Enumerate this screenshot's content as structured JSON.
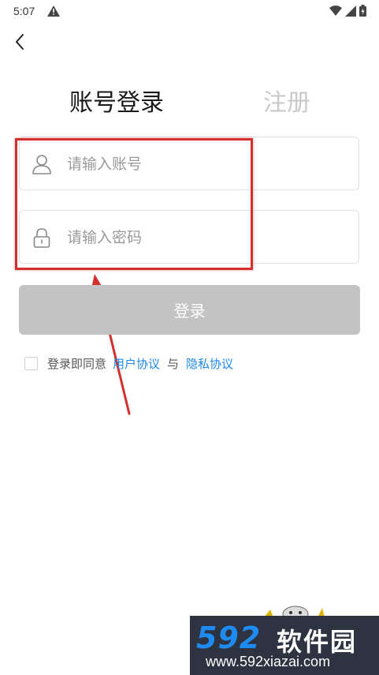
{
  "status_bar": {
    "time": "5:07",
    "icons": [
      "warning-icon",
      "wifi-icon",
      "signal-icon",
      "battery-icon"
    ]
  },
  "nav": {
    "back_icon": "chevron-left-icon"
  },
  "tabs": {
    "login": "账号登录",
    "register": "注册"
  },
  "form": {
    "account_placeholder": "请输入账号",
    "password_placeholder": "请输入密码",
    "account_value": "",
    "password_value": "",
    "submit_label": "登录"
  },
  "agreement": {
    "prefix": "登录即同意",
    "user_agreement": "用户协议",
    "and": "与",
    "privacy_policy": "隐私协议",
    "checked": false
  },
  "colors": {
    "link": "#1e88e5",
    "button_disabled": "#c3c3c3",
    "annotation": "#d32f2f",
    "watermark_bg": "#2e3342",
    "watermark_num": "#1e8bf0"
  },
  "watermark": {
    "number": "592",
    "name": "软件园",
    "url": "www.592xiazai.com"
  }
}
